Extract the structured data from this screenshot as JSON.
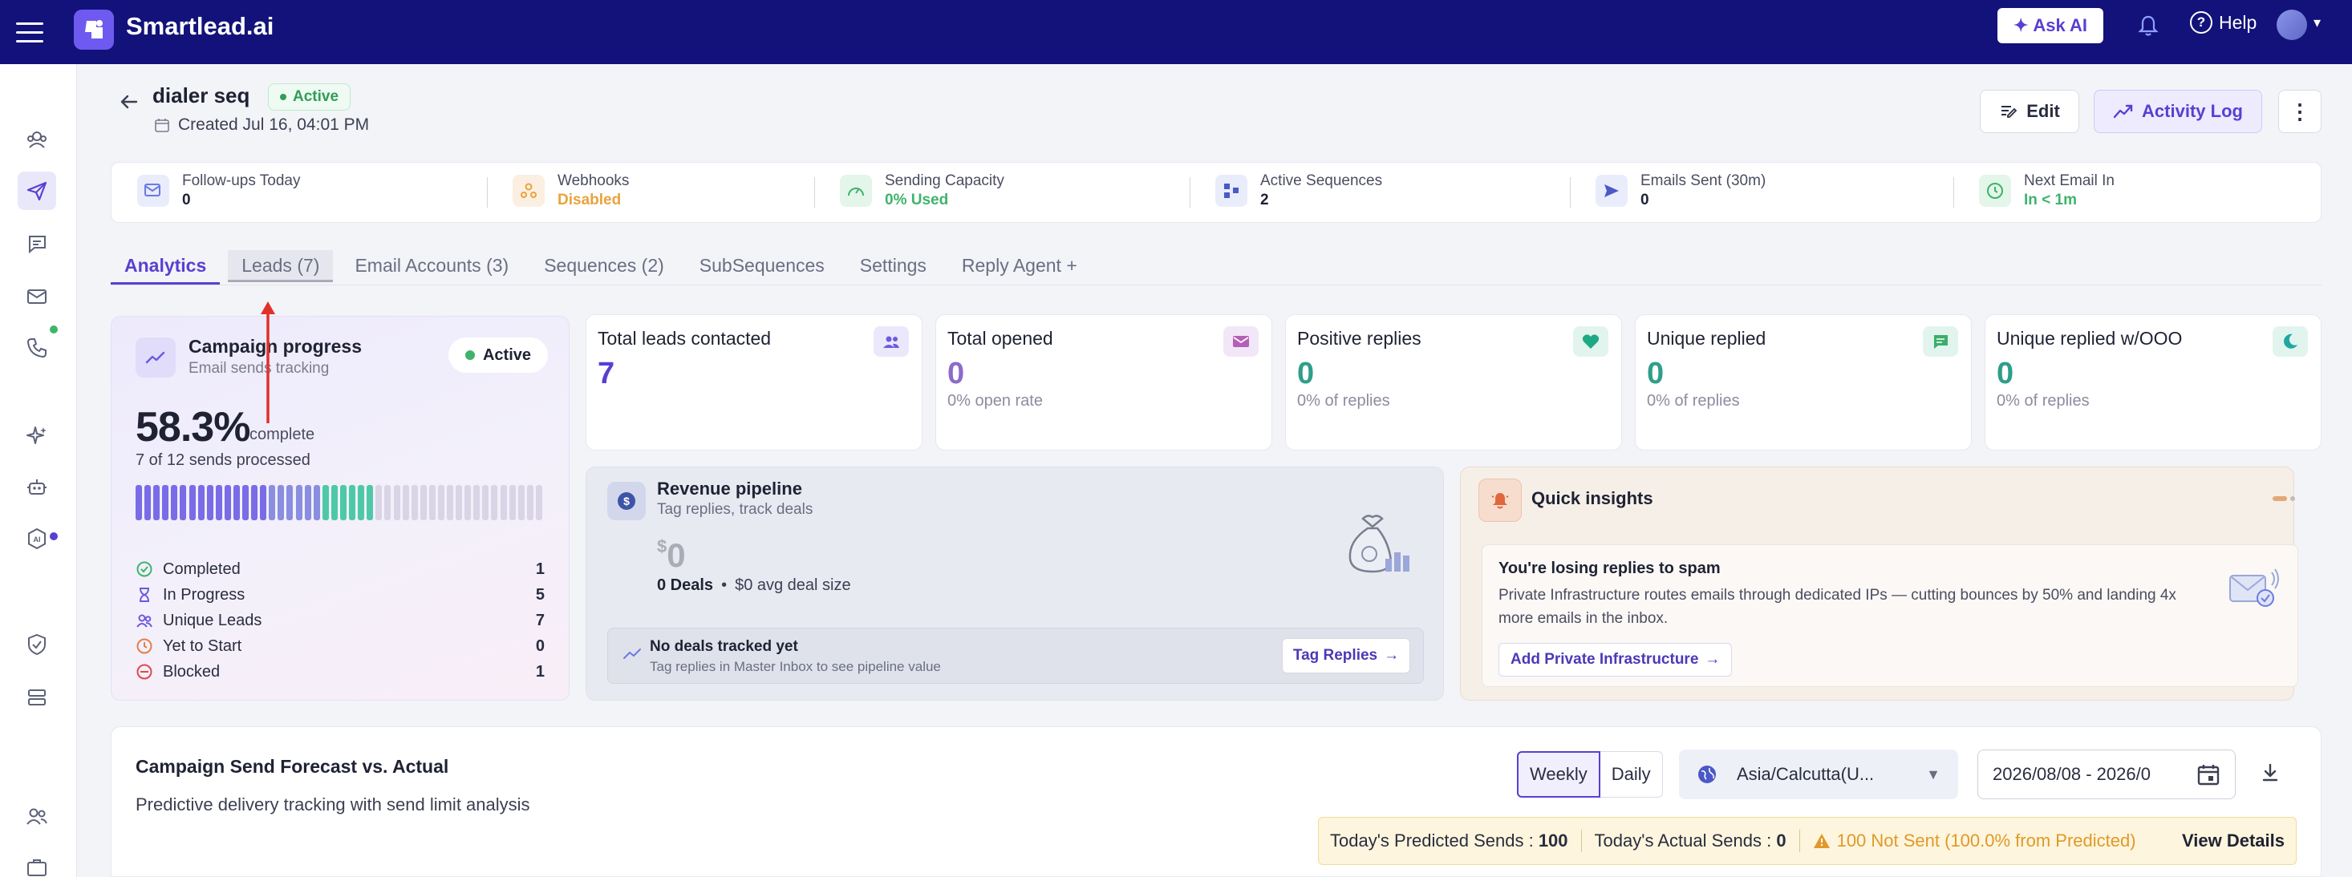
{
  "topbar": {
    "brand": "Smartlead.ai",
    "ask_ai": "Ask AI",
    "help": "Help",
    "help_glyph": "?"
  },
  "campaign": {
    "title": "dialer seq",
    "status": "Active",
    "created": "Created Jul 16, 04:01 PM"
  },
  "actions": {
    "edit": "Edit",
    "activity_log": "Activity Log",
    "more": "⋮"
  },
  "stats": [
    {
      "label": "Follow-ups Today",
      "value": "0",
      "color": "#1f2233",
      "icon": "mail-clock-icon"
    },
    {
      "label": "Webhooks",
      "value": "Disabled",
      "color": "#e8a33c",
      "icon": "webhook-icon"
    },
    {
      "label": "Sending Capacity",
      "value": "0% Used",
      "color": "#3fb36b",
      "icon": "gauge-icon"
    },
    {
      "label": "Active Sequences",
      "value": "2",
      "color": "#1f2233",
      "icon": "sequence-icon"
    },
    {
      "label": "Emails Sent (30m)",
      "value": "0",
      "color": "#1f2233",
      "icon": "send-icon"
    },
    {
      "label": "Next Email In",
      "value": "In < 1m",
      "color": "#3fb36b",
      "icon": "clock-icon"
    }
  ],
  "tabs": [
    {
      "label": "Analytics",
      "active": true
    },
    {
      "label": "Leads (7)",
      "active": false
    },
    {
      "label": "Email Accounts (3)",
      "active": false
    },
    {
      "label": "Sequences (2)",
      "active": false
    },
    {
      "label": "SubSequences",
      "active": false
    },
    {
      "label": "Settings",
      "active": false
    },
    {
      "label": "Reply Agent +",
      "active": false
    }
  ],
  "progress": {
    "title": "Campaign progress",
    "subtitle": "Email sends tracking",
    "status": "Active",
    "percent": "58.3%",
    "complete_label": "complete",
    "sends": "7 of 12 sends processed",
    "completed_fraction": 0.583,
    "legend": [
      {
        "label": "Completed",
        "value": "1",
        "color": "#3fb36b",
        "icon": "check-circle-icon"
      },
      {
        "label": "In Progress",
        "value": "5",
        "color": "#6a5ae0",
        "icon": "hourglass-icon"
      },
      {
        "label": "Unique Leads",
        "value": "7",
        "color": "#6a5ae0",
        "icon": "users-icon"
      },
      {
        "label": "Yet to Start",
        "value": "0",
        "color": "#e67e45",
        "icon": "clock-icon"
      },
      {
        "label": "Blocked",
        "value": "1",
        "color": "#e04848",
        "icon": "blocked-icon"
      }
    ]
  },
  "metrics": [
    {
      "label": "Total leads contacted",
      "value": "7",
      "sub": "",
      "value_color": "#5a3fd1",
      "icon_bg": "#ebe8fc",
      "icon_color": "#6a5ae0",
      "icon": "users-icon"
    },
    {
      "label": "Total opened",
      "value": "0",
      "sub": "0% open rate",
      "value_color": "#8e6ac9",
      "icon_bg": "#f2e7f7",
      "icon_color": "#b45fb8",
      "icon": "mail-icon"
    },
    {
      "label": "Positive replies",
      "value": "0",
      "sub": "0% of replies",
      "value_color": "#2f9e8a",
      "icon_bg": "#e2f4ee",
      "icon_color": "#1fa884",
      "icon": "heart-icon"
    },
    {
      "label": "Unique replied",
      "value": "0",
      "sub": "0% of replies",
      "value_color": "#2f9e8a",
      "icon_bg": "#e2f4ee",
      "icon_color": "#3cae6b",
      "icon": "chat-icon"
    },
    {
      "label": "Unique replied w/OOO",
      "value": "0",
      "sub": "0% of replies",
      "value_color": "#2f9e8a",
      "icon_bg": "#e2f4ee",
      "icon_color": "#1fa8a0",
      "icon": "moon-icon"
    }
  ],
  "revenue": {
    "title": "Revenue pipeline",
    "subtitle": "Tag replies, track deals",
    "currency": "$",
    "amount": "0",
    "deals": "0 Deals",
    "avg": "$0 avg deal size",
    "empty_title": "No deals tracked yet",
    "empty_sub": "Tag replies in Master Inbox to see pipeline value",
    "tag_button": "Tag Replies"
  },
  "insights": {
    "title": "Quick insights",
    "card_title": "You're losing replies to spam",
    "card_text": "Private Infrastructure routes emails through dedicated IPs — cutting bounces by 50% and landing 4x more emails in the inbox.",
    "link": "Add Private Infrastructure"
  },
  "forecast": {
    "title": "Campaign Send Forecast vs. Actual",
    "subtitle": "Predictive delivery tracking with send limit analysis",
    "weekly": "Weekly",
    "daily": "Daily",
    "timezone": "Asia/Calcutta(U...",
    "date_range": "2026/08/08 - 2026/0",
    "predicted_label": "Today's Predicted Sends :",
    "predicted_value": "100",
    "actual_label": "Today's Actual Sends :",
    "actual_value": "0",
    "not_sent": "100 Not Sent (100.0% from Predicted)",
    "details": "View Details"
  }
}
